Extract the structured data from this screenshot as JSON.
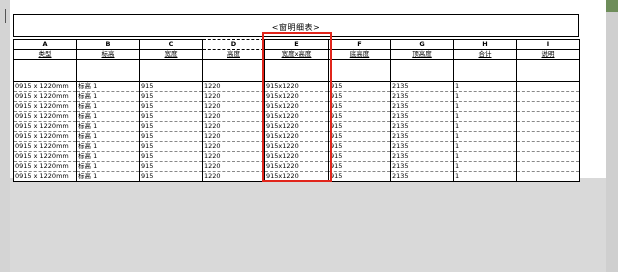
{
  "schedule": {
    "title": "<窗明细表>",
    "column_letters": [
      "A",
      "B",
      "C",
      "D",
      "E",
      "F",
      "G",
      "H",
      "I"
    ],
    "column_labels": [
      "类型",
      "标高",
      "宽度",
      "高度",
      "宽度x高度",
      "底高度",
      "顶高度",
      "合计",
      "说明"
    ],
    "rows": [
      [
        "0915 x 1220mm",
        "标高 1",
        "915",
        "1220",
        "915x1220",
        "915",
        "2135",
        "1",
        ""
      ],
      [
        "0915 x 1220mm",
        "标高 1",
        "915",
        "1220",
        "915x1220",
        "915",
        "2135",
        "1",
        ""
      ],
      [
        "0915 x 1220mm",
        "标高 1",
        "915",
        "1220",
        "915x1220",
        "915",
        "2135",
        "1",
        ""
      ],
      [
        "0915 x 1220mm",
        "标高 1",
        "915",
        "1220",
        "915x1220",
        "915",
        "2135",
        "1",
        ""
      ],
      [
        "0915 x 1220mm",
        "标高 1",
        "915",
        "1220",
        "915x1220",
        "915",
        "2135",
        "1",
        ""
      ],
      [
        "0915 x 1220mm",
        "标高 1",
        "915",
        "1220",
        "915x1220",
        "915",
        "2135",
        "1",
        ""
      ],
      [
        "0915 x 1220mm",
        "标高 1",
        "915",
        "1220",
        "915x1220",
        "915",
        "2135",
        "1",
        ""
      ],
      [
        "0915 x 1220mm",
        "标高 1",
        "915",
        "1220",
        "915x1220",
        "915",
        "2135",
        "1",
        ""
      ],
      [
        "0915 x 1220mm",
        "标高 1",
        "915",
        "1220",
        "915x1220",
        "915",
        "2135",
        "1",
        ""
      ],
      [
        "0915 x 1220mm",
        "标高 1",
        "915",
        "1220",
        "915x1220",
        "915",
        "2135",
        "1",
        ""
      ]
    ]
  },
  "colors": {
    "highlight": "#e1251b",
    "viewport_background": "#d9d9d9"
  }
}
